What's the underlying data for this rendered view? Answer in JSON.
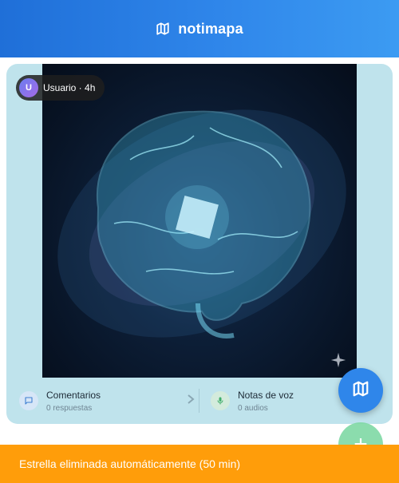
{
  "app": {
    "title": "notimapa",
    "logo_icon": "map-icon"
  },
  "post": {
    "author": "Usuario",
    "avatar_initial": "U",
    "time": "4h",
    "author_time": "Usuario · 4h"
  },
  "actions": {
    "comments": {
      "label": "Comentarios",
      "sub": "0 respuestas",
      "icon": "chat-bubble-icon"
    },
    "voice": {
      "label": "Notas de voz",
      "sub": "0 audios",
      "icon": "microphone-icon"
    }
  },
  "fabs": {
    "map_icon": "map-icon",
    "add_icon": "plus-icon",
    "add_label": "+"
  },
  "toast": {
    "message": "Estrella eliminada automáticamente (50 min)"
  },
  "colors": {
    "header": "#2f86ea",
    "card_bg": "#bfe3ec",
    "toast": "#ff9d0a",
    "fab_add": "#7fd9a5"
  }
}
